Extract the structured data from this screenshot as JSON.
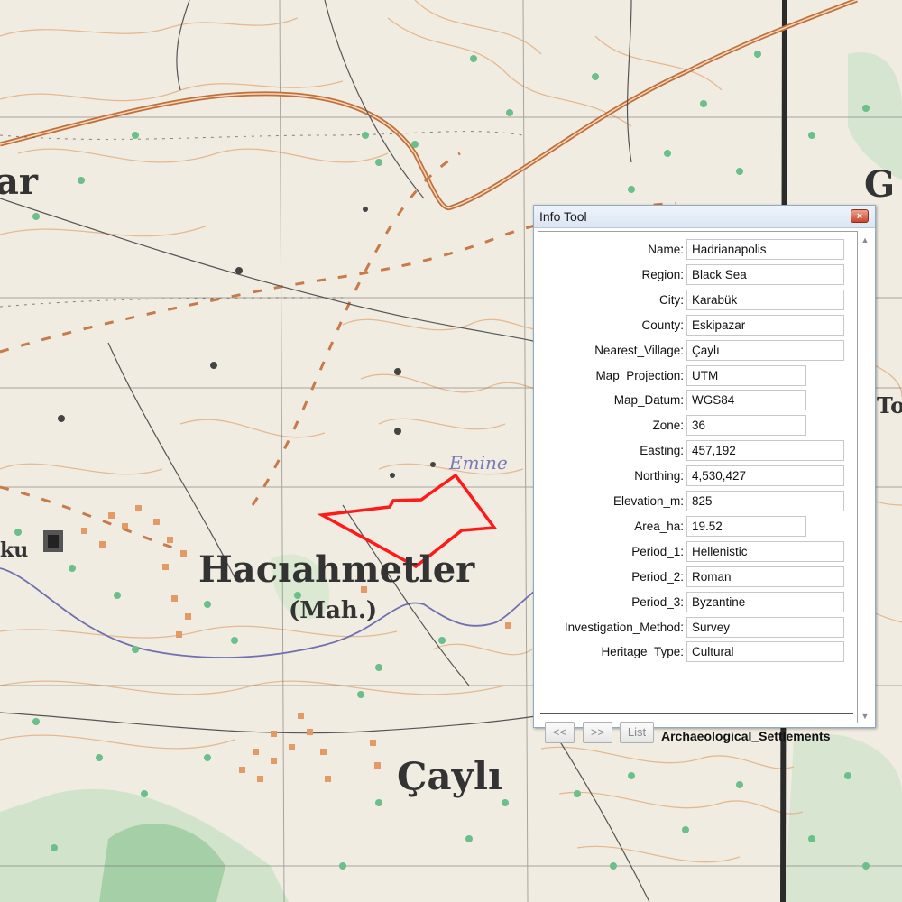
{
  "map": {
    "labels": {
      "hacıahmetler": "Hacıahmetler",
      "mah": "(Mah.)",
      "cayli": "Çaylı",
      "emine": "Emine",
      "top_left_fragment": "ar",
      "left_fragment": "ku",
      "right_fragment_g": "G",
      "right_fragment_to": "To"
    }
  },
  "info_tool": {
    "title": "Info Tool",
    "close_label": "×",
    "fields": [
      {
        "label": "Name:",
        "value": "Hadrianapolis"
      },
      {
        "label": "Region:",
        "value": "Black Sea"
      },
      {
        "label": "City:",
        "value": "Karabük"
      },
      {
        "label": "County:",
        "value": "Eskipazar"
      },
      {
        "label": "Nearest_Village:",
        "value": "Çaylı"
      },
      {
        "label": "Map_Projection:",
        "value": "UTM"
      },
      {
        "label": "Map_Datum:",
        "value": "WGS84"
      },
      {
        "label": "Zone:",
        "value": "36"
      },
      {
        "label": "Easting:",
        "value": "457,192"
      },
      {
        "label": "Northing:",
        "value": "4,530,427"
      },
      {
        "label": "Elevation_m:",
        "value": "825"
      },
      {
        "label": "Area_ha:",
        "value": "19.52"
      },
      {
        "label": "Period_1:",
        "value": "Hellenistic"
      },
      {
        "label": "Period_2:",
        "value": "Roman"
      },
      {
        "label": "Period_3:",
        "value": "Byzantine"
      },
      {
        "label": "Investigation_Method:",
        "value": "Survey"
      },
      {
        "label": "Heritage_Type:",
        "value": "Cultural"
      }
    ],
    "prev_label": "<<",
    "next_label": ">>",
    "list_label": "List",
    "layer_name": "Archaeological_Settlements",
    "scroll_up": "▲",
    "scroll_down": "▼"
  },
  "colors": {
    "site_outline": "#ff1a1a",
    "road": "#c0703a",
    "contour": "#e0a070",
    "river": "#6a6aa8",
    "vegetation": "#6abf8a"
  }
}
